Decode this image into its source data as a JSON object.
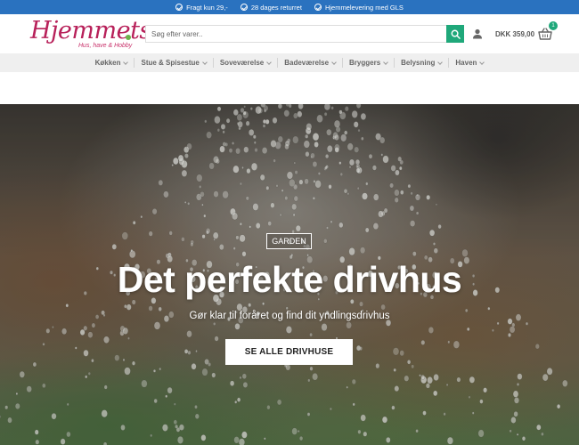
{
  "topbar": {
    "items": [
      "Fragt kun 29,-",
      "28 dages returret",
      "Hjemmelevering med GLS"
    ]
  },
  "header": {
    "logo_text": "Hjemmets",
    "logo_tagline": "Hus, have & Hobby",
    "search_placeholder": "Søg efter varer..",
    "cart_total": "DKK 359,00",
    "cart_count": "1"
  },
  "nav": {
    "items": [
      "Køkken",
      "Stue & Spisestue",
      "Soveværelse",
      "Badeværelse",
      "Bryggers",
      "Belysning",
      "Haven"
    ]
  },
  "hero": {
    "tag": "GARDEN",
    "title": "Det perfekte drivhus",
    "subtitle": "Gør klar til foråret og find dit yndlingsdrivhus",
    "cta": "SE ALLE DRIVHUSE"
  },
  "colors": {
    "topbar": "#2a72bf",
    "accent": "#1fa87a",
    "logo": "#b8215a",
    "nav_bg": "#efefef"
  },
  "icons": [
    "check-icon",
    "search-icon",
    "user-icon",
    "basket-icon",
    "chevron-down-icon"
  ]
}
